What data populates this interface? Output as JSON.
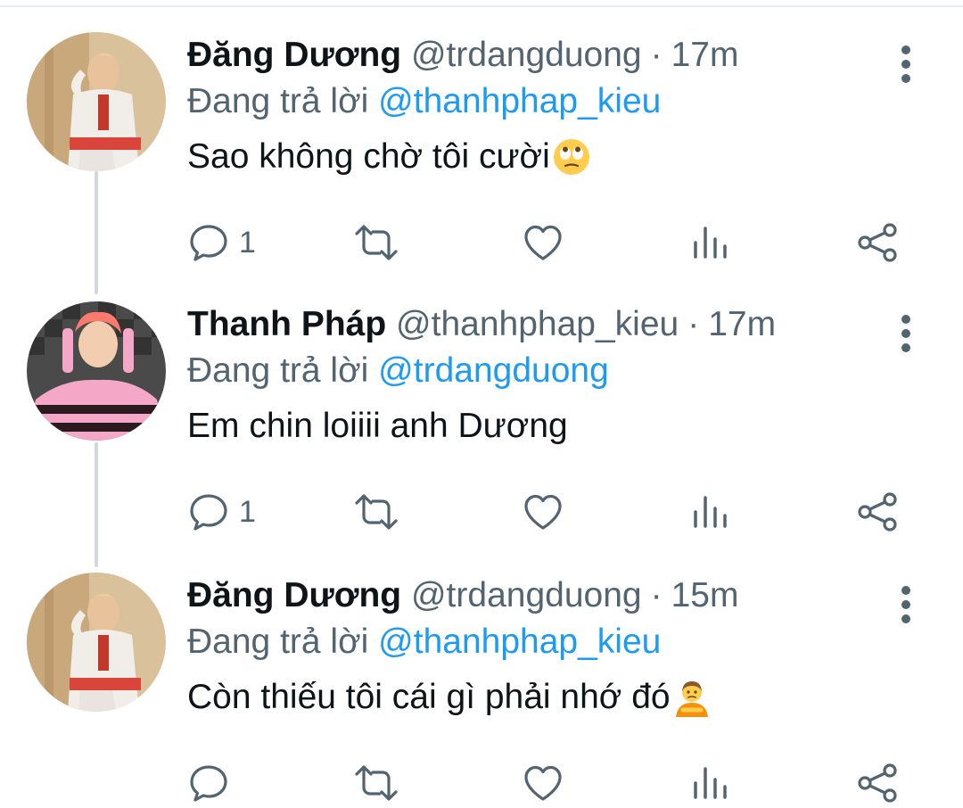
{
  "tweets": [
    {
      "name": "Đăng Dương",
      "handle": "@trdangduong",
      "separator": "·",
      "time": "17m",
      "replying_prefix": "Đang trả lời ",
      "replying_to": "@thanhphap_kieu",
      "text": "Sao không chờ tôi cười",
      "emoji": "face-with-rolling-eyes",
      "reply_count": "1",
      "retweet_count": "",
      "like_count": ""
    },
    {
      "name": "Thanh Pháp",
      "handle": "@thanhphap_kieu",
      "separator": "·",
      "time": "17m",
      "replying_prefix": "Đang trả lời ",
      "replying_to": "@trdangduong",
      "text": "Em chin loiiii anh Dương",
      "emoji": "",
      "reply_count": "1",
      "retweet_count": "",
      "like_count": ""
    },
    {
      "name": "Đăng Dương",
      "handle": "@trdangduong",
      "separator": "·",
      "time": "15m",
      "replying_prefix": "Đang trả lời ",
      "replying_to": "@thanhphap_kieu",
      "text": "Còn thiếu tôi cái gì phải nhớ đó",
      "emoji": "person-pouting",
      "reply_count": "",
      "retweet_count": "",
      "like_count": ""
    }
  ],
  "icons": {
    "reply": "reply-icon",
    "retweet": "retweet-icon",
    "like": "like-icon",
    "analytics": "analytics-icon",
    "share": "share-icon",
    "more": "more-vertical-icon"
  },
  "colors": {
    "text_primary": "#0f1419",
    "text_secondary": "#536471",
    "mention": "#1d9bf0",
    "thread_line": "#cfd9de"
  }
}
